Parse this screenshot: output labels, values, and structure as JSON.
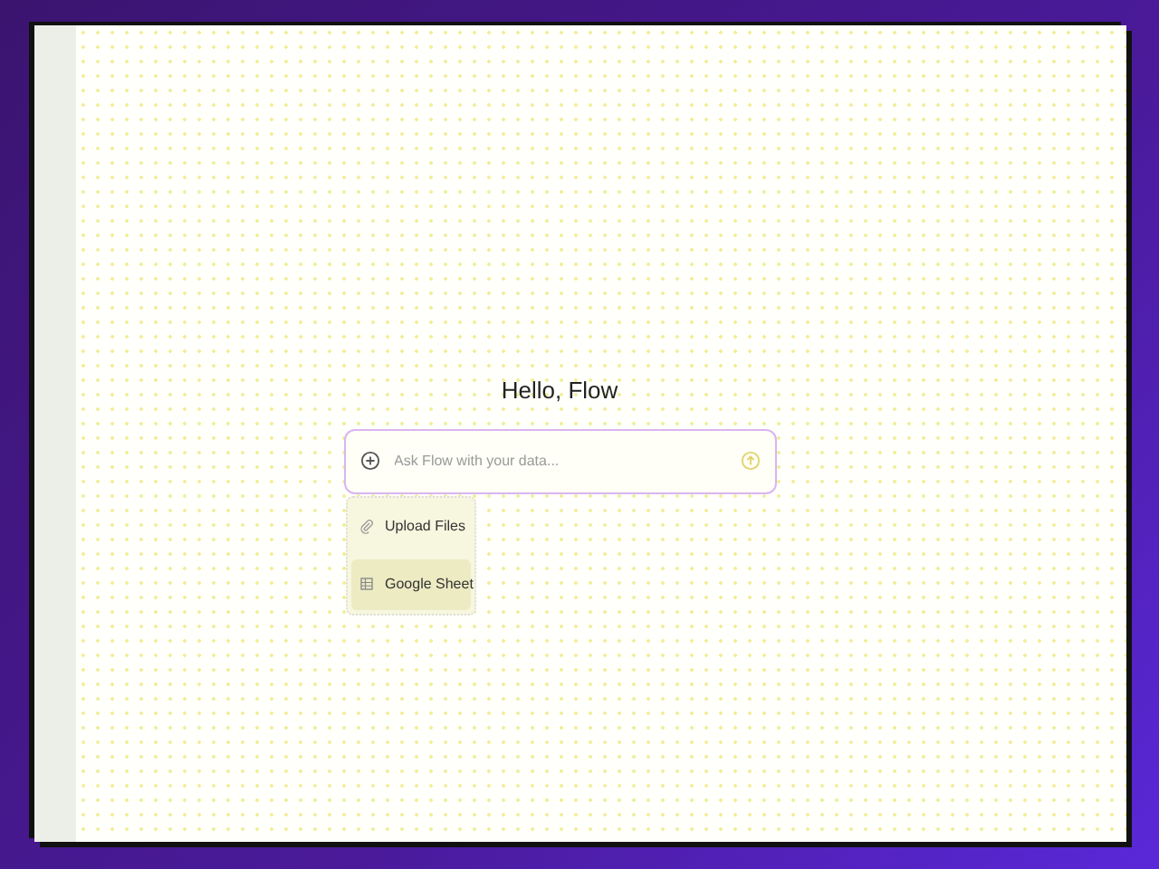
{
  "greeting": "Hello, Flow",
  "prompt": {
    "placeholder": "Ask Flow with your data..."
  },
  "attach_menu": {
    "items": [
      {
        "label": "Upload Files",
        "kind": "upload",
        "selected": false
      },
      {
        "label": "Google Sheet",
        "kind": "sheet",
        "selected": true
      }
    ]
  }
}
